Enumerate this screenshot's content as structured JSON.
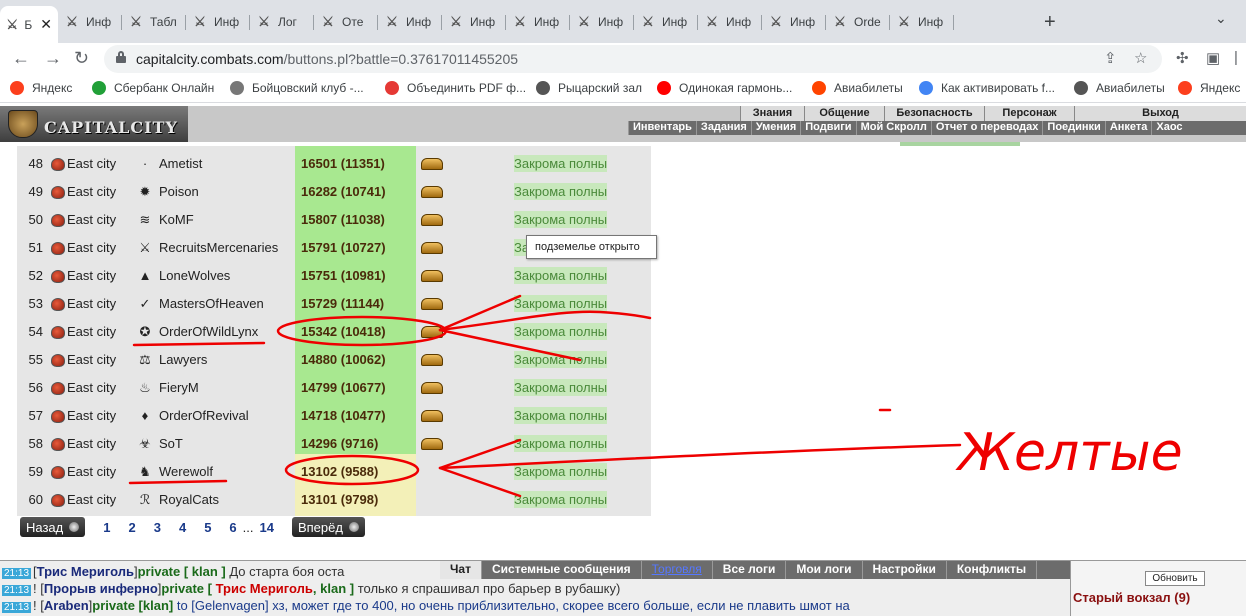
{
  "browser": {
    "tabs": [
      {
        "label": "Б",
        "icon": "crossed-swords-icon",
        "active": true
      },
      {
        "label": "Инф",
        "icon": "crossed-swords-icon"
      },
      {
        "label": "Табл",
        "icon": "crossed-swords-icon"
      },
      {
        "label": "Инф",
        "icon": "crossed-swords-icon"
      },
      {
        "label": "Лог",
        "icon": "crossed-swords-icon"
      },
      {
        "label": "Оте",
        "icon": "crossed-swords-icon"
      },
      {
        "label": "Инф",
        "icon": "crossed-swords-icon"
      },
      {
        "label": "Инф",
        "icon": "crossed-swords-icon"
      },
      {
        "label": "Инф",
        "icon": "crossed-swords-icon"
      },
      {
        "label": "Инф",
        "icon": "crossed-swords-icon"
      },
      {
        "label": "Инф",
        "icon": "crossed-swords-icon"
      },
      {
        "label": "Инф",
        "icon": "crossed-swords-icon"
      },
      {
        "label": "Инф",
        "icon": "crossed-swords-icon"
      },
      {
        "label": "Orde",
        "icon": "crossed-swords-icon"
      },
      {
        "label": "Инф",
        "icon": "crossed-swords-icon"
      }
    ],
    "url_domain": "capitalcity.combats.com",
    "url_path": "/buttons.pl?battle=0.37617011455205",
    "bookmarks": [
      {
        "label": "Яндекс",
        "color": "#fc3f1d"
      },
      {
        "label": "Сбербанк Онлайн",
        "color": "#21a038"
      },
      {
        "label": "Бойцовский клуб -...",
        "color": "#777777"
      },
      {
        "label": "Объединить PDF ф...",
        "color": "#e53935"
      },
      {
        "label": "Рыцарский зал",
        "color": "#555555"
      },
      {
        "label": "Одинокая гармонь...",
        "color": "#ff0000"
      },
      {
        "label": "Авиабилеты",
        "color": "#ff4400"
      },
      {
        "label": "Как активировать f...",
        "color": "#4285f4"
      },
      {
        "label": "Авиабилеты",
        "color": "#555555"
      },
      {
        "label": "Яндекс",
        "color": "#fc3f1d"
      }
    ]
  },
  "game": {
    "logo_text": "CAPITALCITY",
    "menu_top": [
      "Знания",
      "Общение",
      "Безопасность",
      "Персонаж",
      "Выход"
    ],
    "menu_bottom": [
      "Инвентарь",
      "Задания",
      "Умения",
      "Подвиги",
      "Мой Скролл",
      "Отчет о переводах",
      "Поединки",
      "Анкета",
      "Хаос"
    ]
  },
  "ranking": {
    "rows": [
      {
        "num": "48",
        "city": "East city",
        "clan": "Ametist",
        "clan_icon": "·",
        "score": "16501 (11351)",
        "status": "Закрома полны",
        "chest": true
      },
      {
        "num": "49",
        "city": "East city",
        "clan": "Poison",
        "clan_icon": "✹",
        "score": "16282 (10741)",
        "status": "Закрома полны",
        "chest": true
      },
      {
        "num": "50",
        "city": "East city",
        "clan": "KoMF",
        "clan_icon": "≋",
        "score": "15807 (11038)",
        "status": "Закрома полны",
        "chest": true
      },
      {
        "num": "51",
        "city": "East city",
        "clan": "RecruitsMercenaries",
        "clan_icon": "⚔",
        "score": "15791 (10727)",
        "status": "Закрома полны",
        "chest": true
      },
      {
        "num": "52",
        "city": "East city",
        "clan": "LoneWolves",
        "clan_icon": "▲",
        "score": "15751 (10981)",
        "status": "Закрома полны",
        "chest": true
      },
      {
        "num": "53",
        "city": "East city",
        "clan": "MastersOfHeaven",
        "clan_icon": "✓",
        "score": "15729 (11144)",
        "status": "Закрома полны",
        "chest": true
      },
      {
        "num": "54",
        "city": "East city",
        "clan": "OrderOfWildLynx",
        "clan_icon": "✪",
        "score": "15342 (10418)",
        "status": "Закрома полны",
        "chest": true
      },
      {
        "num": "55",
        "city": "East city",
        "clan": "Lawyers",
        "clan_icon": "⚖",
        "score": "14880 (10062)",
        "status": "Закрома полны",
        "chest": true
      },
      {
        "num": "56",
        "city": "East city",
        "clan": "FieryM",
        "clan_icon": "♨",
        "score": "14799 (10677)",
        "status": "Закрома полны",
        "chest": true
      },
      {
        "num": "57",
        "city": "East city",
        "clan": "OrderOfRevival",
        "clan_icon": "♦",
        "score": "14718 (10477)",
        "status": "Закрома полны",
        "chest": true
      },
      {
        "num": "58",
        "city": "East city",
        "clan": "SoT",
        "clan_icon": "☣",
        "score": "14296 (9716)",
        "status": "Закрома полны",
        "chest": true
      },
      {
        "num": "59",
        "city": "East city",
        "clan": "Werewolf",
        "clan_icon": "♞",
        "score": "13102 (9588)",
        "status": "Закрома полны",
        "chest": false
      },
      {
        "num": "60",
        "city": "East city",
        "clan": "RoyalCats",
        "clan_icon": "ℛ",
        "score": "13101 (9798)",
        "status": "Закрома полны",
        "chest": false
      }
    ],
    "pager": {
      "prev": "Назад",
      "next": "Вперёд",
      "pages": [
        "1",
        "2",
        "3",
        "4",
        "5",
        "6",
        "...",
        "14"
      ]
    },
    "tooltip": "подземелье открыто"
  },
  "annotation_text": "Желтые",
  "chat": {
    "tabs": [
      "Чат",
      "Системные сообщения",
      "Торговля",
      "Все логи",
      "Мои логи",
      "Настройки",
      "Конфликты"
    ],
    "lines": [
      {
        "time": "21:13",
        "open": "[",
        "nick": "Трис Мериголь",
        "close": "]",
        "priv": "private [ klan ]",
        "text": " До старта боя оста"
      },
      {
        "time": "21:13",
        "open": "! [",
        "nick": "Прорыв инферно",
        "close": "]",
        "priv": "private [",
        "red": " Трис Мериголь",
        "priv2": ", klan ]",
        "text": " только я спрашивал про барьер в рубашку)"
      },
      {
        "time": "21:13",
        "open": "! [",
        "nick": "Araben",
        "close": "]",
        "priv": "private [klan]",
        "text": " to [Gelenvagen] хз, может где то 400, но очень приблизительно, скорее всего больше, если не плавить шмот на"
      }
    ],
    "refresh": "Обновить",
    "place": "Старый вокзал (9)"
  }
}
